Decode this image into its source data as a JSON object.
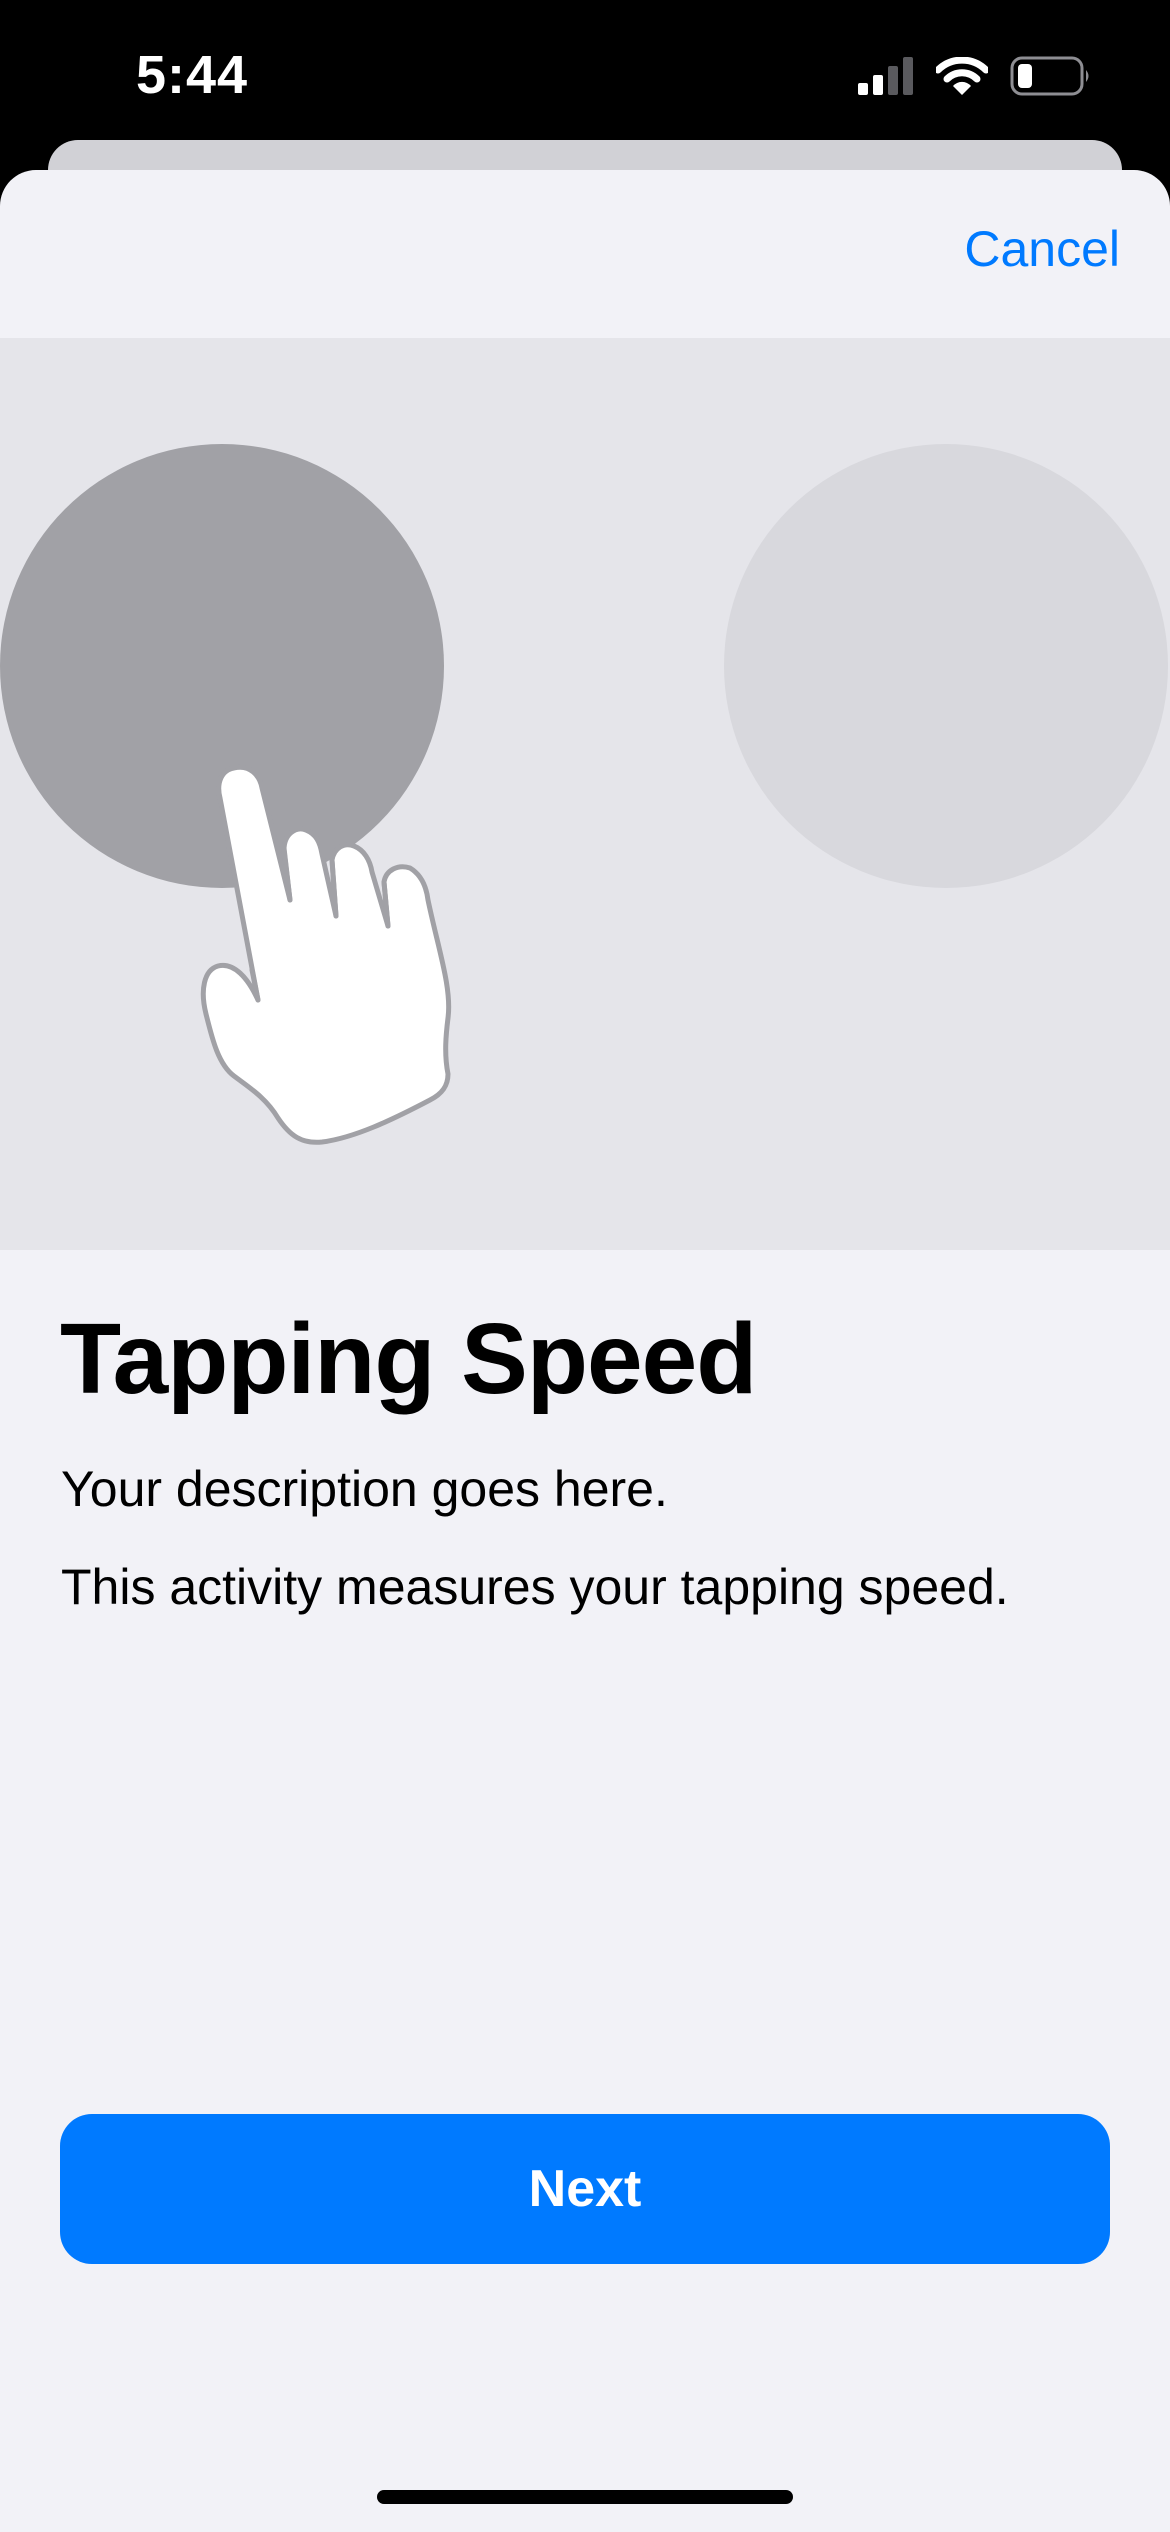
{
  "status_bar": {
    "time": "5:44",
    "icons": [
      "cellular-signal-icon",
      "wifi-icon",
      "battery-icon"
    ]
  },
  "nav": {
    "cancel_label": "Cancel"
  },
  "illustration": {
    "icons": [
      "tap-target-left-icon",
      "tap-target-right-icon",
      "hand-pointer-icon"
    ]
  },
  "content": {
    "title": "Tapping Speed",
    "description": "Your description goes here.",
    "detail": "This activity measures your tapping speed."
  },
  "footer": {
    "next_label": "Next"
  },
  "colors": {
    "accent": "#007aff",
    "sheet_background": "#f2f2f7",
    "illustration_background": "#e5e5ea",
    "active_target": "#a1a1a6",
    "inactive_target": "#d8d8dd"
  }
}
